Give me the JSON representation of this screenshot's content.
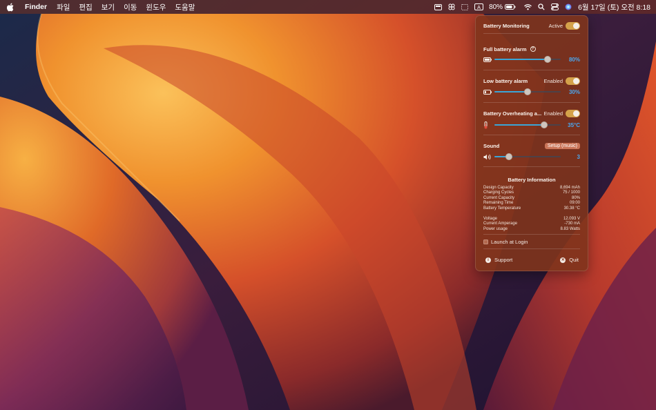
{
  "menubar": {
    "app_name": "Finder",
    "menus": [
      "파일",
      "편집",
      "보기",
      "이동",
      "윈도우",
      "도움말"
    ],
    "battery_percent": "80%",
    "keyboard_input": "A",
    "clock": "6월 17일 (토) 오전 8:18"
  },
  "panel": {
    "monitoring": {
      "title": "Battery Monitoring",
      "status": "Active",
      "enabled": true
    },
    "full_alarm": {
      "title": "Full battery alarm",
      "value_label": "80%",
      "value": 80,
      "min": 0,
      "max": 100
    },
    "low_alarm": {
      "title": "Low battery alarm",
      "status": "Enabled",
      "enabled": true,
      "value_label": "30%",
      "value": 30,
      "min": 0,
      "max": 60
    },
    "overheat": {
      "title": "Battery Overheating a...",
      "status": "Enabled",
      "enabled": true,
      "value_label": "35°C",
      "value": 35,
      "min": 20,
      "max": 40
    },
    "sound": {
      "title": "Sound",
      "setup_label": "Setup (music)",
      "value_label": "3",
      "value": 3,
      "min": 1,
      "max": 10
    },
    "info": {
      "title": "Battery Information",
      "group1": [
        {
          "label": "Design Capacity",
          "value": "8,694 mAh"
        },
        {
          "label": "Charging Cycles",
          "value": "75 / 1000"
        },
        {
          "label": "Current Capacity",
          "value": "80%"
        },
        {
          "label": "Remaining Time",
          "value": "09:00"
        },
        {
          "label": "Battery Temperature",
          "value": "30.38 °C"
        }
      ],
      "group2": [
        {
          "label": "Voltage",
          "value": "12.093 V"
        },
        {
          "label": "Current Amperage",
          "value": "-730 mA"
        },
        {
          "label": "Power usage",
          "value": "8.83 Watts"
        }
      ]
    },
    "launch_label": "Launch at Login",
    "launch_checked": false,
    "support_label": "Support",
    "quit_label": "Quit"
  },
  "colors": {
    "accent_toggle": "#d4a24a",
    "slider_fill": "#3aa6d8",
    "value_blue": "#4aa8f0"
  }
}
